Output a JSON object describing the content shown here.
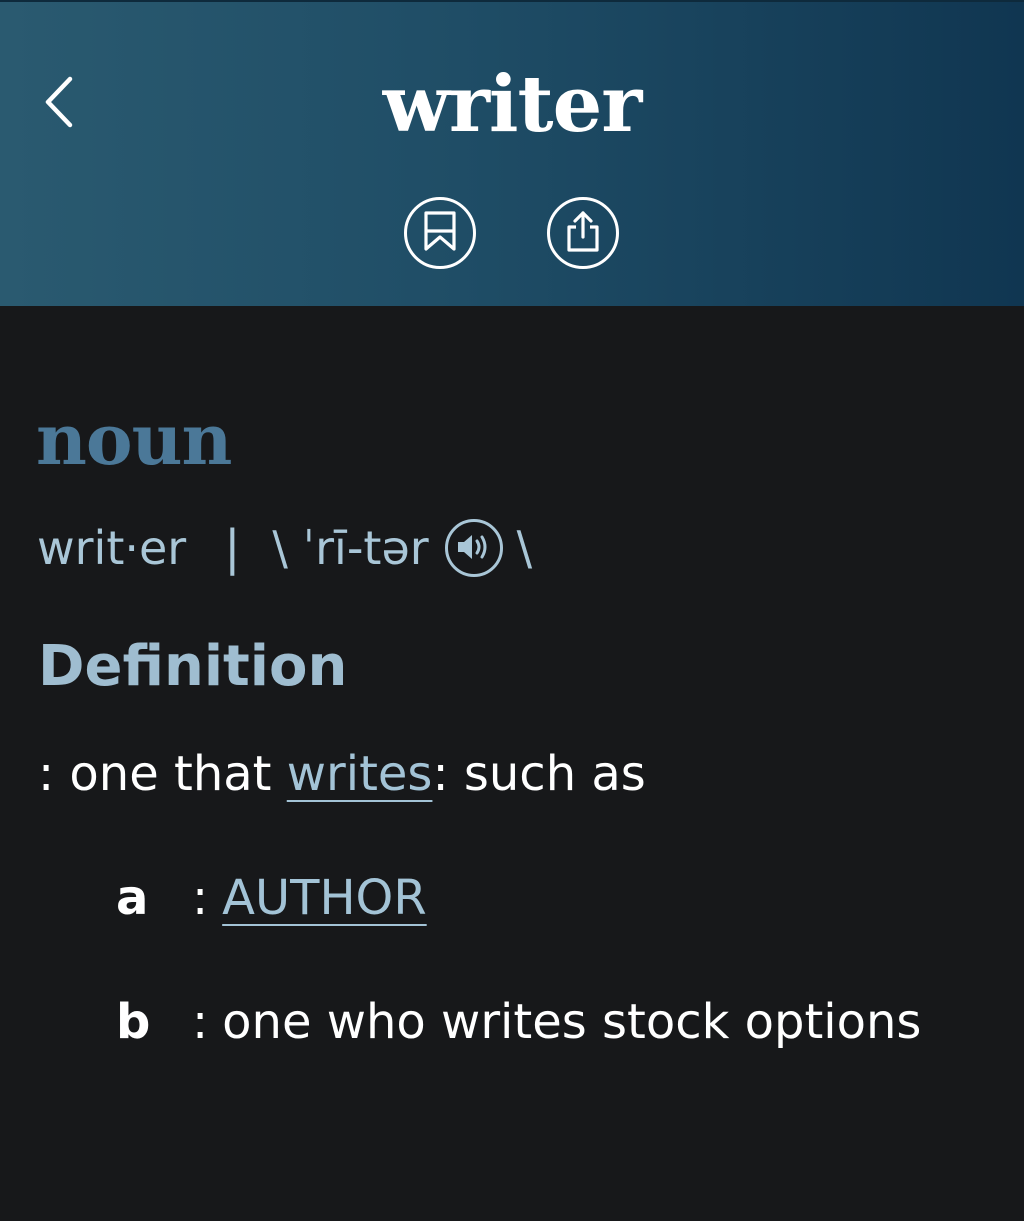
{
  "header": {
    "title": "writer",
    "gradient_colors": [
      "#2a5a70",
      "#103651"
    ]
  },
  "icons": {
    "back": "chevron-left-icon",
    "bookmark": "bookmark-icon",
    "share": "share-icon",
    "speaker": "speaker-icon"
  },
  "entry": {
    "part_of_speech": "noun",
    "syllables": "writ·er",
    "separator": "|",
    "pron_open": "\\ ˈrī-tər",
    "pron_close": "\\",
    "definition_heading": "Definition",
    "definition": {
      "prefix": ": one that ",
      "link": "writes",
      "suffix": ": such as"
    },
    "senses": [
      {
        "letter": "a",
        "colon": ":",
        "text": "AUTHOR",
        "is_link": true
      },
      {
        "letter": "b",
        "colon": ":",
        "text": "one who writes stock options",
        "is_link": false
      }
    ]
  },
  "colors": {
    "background": "#17181a",
    "pos_color": "#4b7898",
    "link_color": "#a3c3d6",
    "heading_color": "#9fbdd0"
  }
}
